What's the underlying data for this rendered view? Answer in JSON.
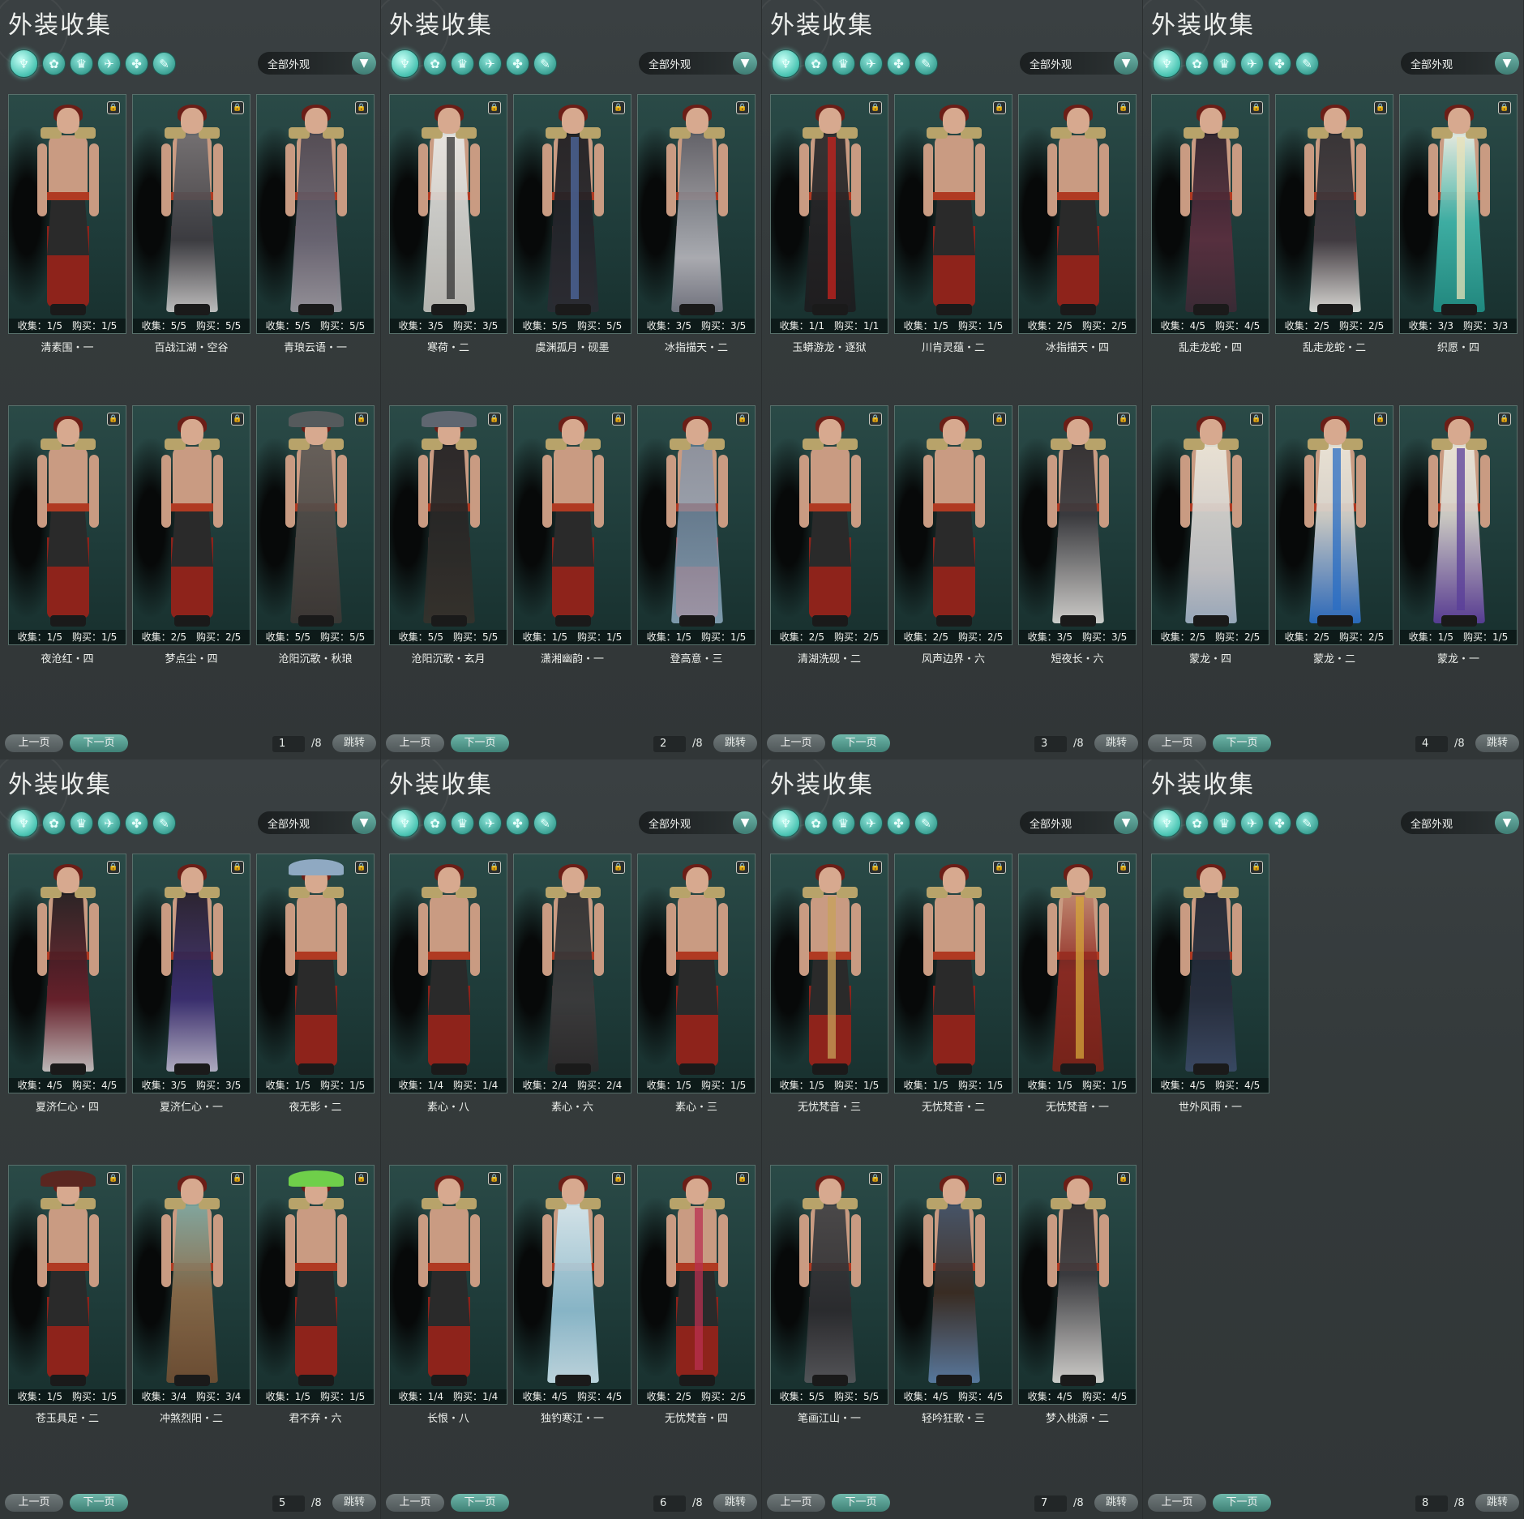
{
  "panels": [
    {
      "title": "外装收集",
      "dropdown_label": "全部外观",
      "page": "1",
      "page_total": "/8",
      "cards": [
        {
          "stats": "收集：1/5　购买：1/5",
          "name": "清素围・一",
          "outfit": "bare"
        },
        {
          "stats": "收集：5/5　购买：5/5",
          "name": "百战江湖・空谷",
          "outfit": "grey"
        },
        {
          "stats": "收集：5/5　购买：5/5",
          "name": "青琅云语・一",
          "outfit": "greyviolet"
        },
        {
          "stats": "收集：1/5　购买：1/5",
          "name": "夜沧红・四",
          "outfit": "bare"
        },
        {
          "stats": "收集：2/5　购买：2/5",
          "name": "梦点尘・四",
          "outfit": "bare"
        },
        {
          "stats": "收集：5/5　购买：5/5",
          "name": "沧阳沉歌・秋琅",
          "outfit": "hatgrey"
        }
      ]
    },
    {
      "title": "外装收集",
      "dropdown_label": "全部外观",
      "page": "2",
      "page_total": "/8",
      "cards": [
        {
          "stats": "收集：3/5　购买：3/5",
          "name": "寒荷・二",
          "outfit": "white"
        },
        {
          "stats": "收集：5/5　购买：5/5",
          "name": "虞渊孤月・砚墨",
          "outfit": "black"
        },
        {
          "stats": "收集：3/5　购买：3/5",
          "name": "冰指描天・二",
          "outfit": "silver"
        },
        {
          "stats": "收集：5/5　购买：5/5",
          "name": "沧阳沉歌・玄月",
          "outfit": "hatblack"
        },
        {
          "stats": "收集：1/5　购买：1/5",
          "name": "潇湘幽韵・一",
          "outfit": "bare"
        },
        {
          "stats": "收集：1/5　购买：1/5",
          "name": "登高意・三",
          "outfit": "bluebare"
        }
      ]
    },
    {
      "title": "外装收集",
      "dropdown_label": "全部外观",
      "page": "3",
      "page_total": "/8",
      "cards": [
        {
          "stats": "收集：1/1　购买：1/1",
          "name": "玉蟒游龙・逐狱",
          "outfit": "redscarf"
        },
        {
          "stats": "收集：1/5　购买：1/5",
          "name": "川肯灵蕴・二",
          "outfit": "bare"
        },
        {
          "stats": "收集：2/5　购买：2/5",
          "name": "冰指描天・四",
          "outfit": "bare"
        },
        {
          "stats": "收集：2/5　购买：2/5",
          "name": "清湖洗砚・二",
          "outfit": "bare"
        },
        {
          "stats": "收集：2/5　购买：2/5",
          "name": "风声边界・六",
          "outfit": "bare"
        },
        {
          "stats": "收集：3/5　购买：3/5",
          "name": "短夜长・六",
          "outfit": "blackwhite"
        }
      ]
    },
    {
      "title": "外装收集",
      "dropdown_label": "全部外观",
      "page": "4",
      "page_total": "/8",
      "cards": [
        {
          "stats": "收集：4/5　购买：4/5",
          "name": "乱走龙蛇・四",
          "outfit": "maroon"
        },
        {
          "stats": "收集：2/5　购买：2/5",
          "name": "乱走龙蛇・二",
          "outfit": "darkwhite"
        },
        {
          "stats": "收集：3/3　购买：3/3",
          "name": "织愿・四",
          "outfit": "teal"
        },
        {
          "stats": "收集：2/5　购买：2/5",
          "name": "蒙龙・四",
          "outfit": "cream"
        },
        {
          "stats": "收集：2/5　购买：2/5",
          "name": "蒙龙・二",
          "outfit": "creamblue"
        },
        {
          "stats": "收集：1/5　购买：1/5",
          "name": "蒙龙・一",
          "outfit": "creampurple"
        }
      ]
    },
    {
      "title": "外装收集",
      "dropdown_label": "全部外观",
      "page": "5",
      "page_total": "/8",
      "cards": [
        {
          "stats": "收集：4/5　购买：4/5",
          "name": "夏济仁心・四",
          "outfit": "crimson"
        },
        {
          "stats": "收集：3/5　购买：3/5",
          "name": "夏济仁心・一",
          "outfit": "indigo"
        },
        {
          "stats": "收集：1/5　购买：1/5",
          "name": "夜无影・二",
          "outfit": "bluehat"
        },
        {
          "stats": "收集：1/5　购买：1/5",
          "name": "苍玉具足・二",
          "outfit": "redhat"
        },
        {
          "stats": "收集：3/4　购买：3/4",
          "name": "冲煞烈阳・二",
          "outfit": "tan"
        },
        {
          "stats": "收集：1/5　购买：1/5",
          "name": "君不弃・六",
          "outfit": "greenhat"
        }
      ]
    },
    {
      "title": "外装收集",
      "dropdown_label": "全部外观",
      "page": "6",
      "page_total": "/8",
      "cards": [
        {
          "stats": "收集：1/4　购买：1/4",
          "name": "素心・八",
          "outfit": "bare"
        },
        {
          "stats": "收集：2/4　购买：2/4",
          "name": "素心・六",
          "outfit": "darkrobe"
        },
        {
          "stats": "收集：1/5　购买：1/5",
          "name": "素心・三",
          "outfit": "bare"
        },
        {
          "stats": "收集：1/4　购买：1/4",
          "name": "长恨・八",
          "outfit": "bare"
        },
        {
          "stats": "收集：4/5　购买：4/5",
          "name": "独钓寒江・一",
          "outfit": "icyblue"
        },
        {
          "stats": "收集：2/5　购买：2/5",
          "name": "无忧梵音・四",
          "outfit": "pinkbare"
        }
      ]
    },
    {
      "title": "外装收集",
      "dropdown_label": "全部外观",
      "page": "7",
      "page_total": "/8",
      "cards": [
        {
          "stats": "收集：1/5　购买：1/5",
          "name": "无忧梵音・三",
          "outfit": "goldbare"
        },
        {
          "stats": "收集：1/5　购买：1/5",
          "name": "无忧梵音・二",
          "outfit": "bare"
        },
        {
          "stats": "收集：1/5　购买：1/5",
          "name": "无忧梵音・一",
          "outfit": "redgold"
        },
        {
          "stats": "收集：5/5　购买：5/5",
          "name": "笔画江山・一",
          "outfit": "charcoal"
        },
        {
          "stats": "收集：4/5　购买：4/5",
          "name": "轻吟狂歌・三",
          "outfit": "bluebrown"
        },
        {
          "stats": "收集：4/5　购买：4/5",
          "name": "梦入桃源・二",
          "outfit": "blackwhite"
        }
      ]
    },
    {
      "title": "外装收集",
      "dropdown_label": "全部外观",
      "page": "8",
      "page_total": "/8",
      "cards": [
        {
          "stats": "收集：4/5　购买：4/5",
          "name": "世外风雨・一",
          "outfit": "navy"
        }
      ]
    }
  ],
  "filter_icons": [
    "all-outfits-icon",
    "robe-icon",
    "top-icon",
    "boots-icon",
    "bracer-icon",
    "scroll-icon"
  ],
  "labels": {
    "prev": "上一页",
    "next": "下一页",
    "jump": "跳转"
  }
}
